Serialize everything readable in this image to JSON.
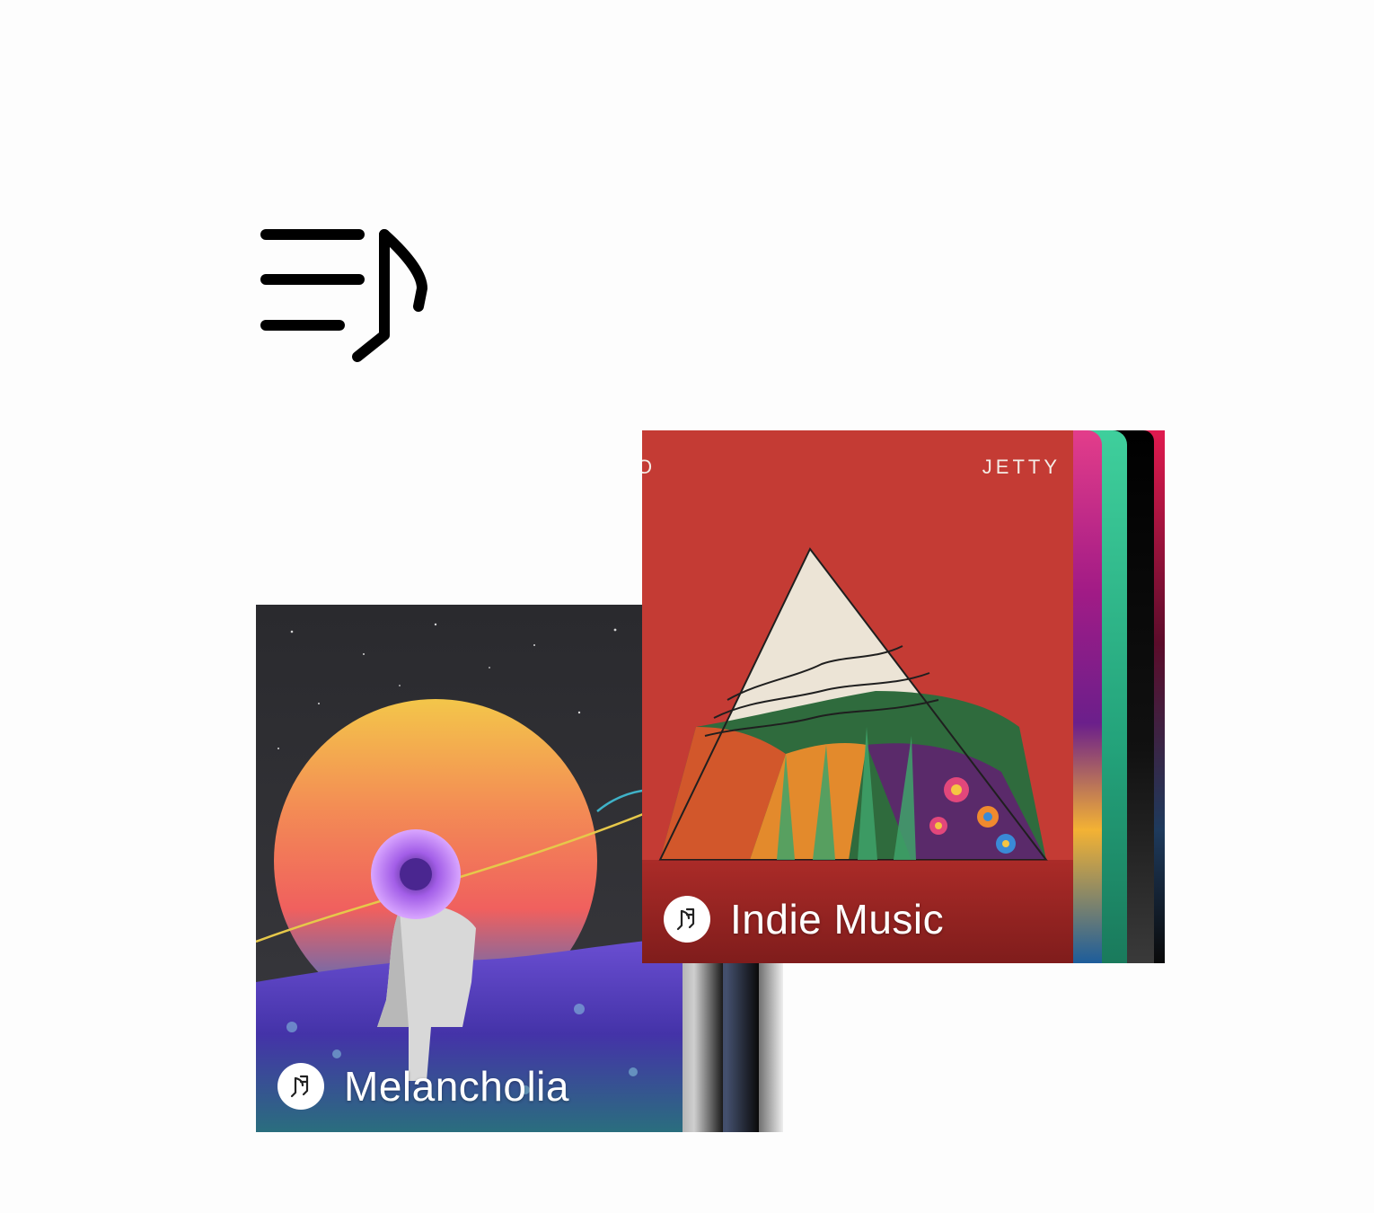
{
  "playlist_icon": "playlist-music-icon",
  "cards": {
    "melancholia": {
      "title": "Melancholia",
      "badge_icon": "music-note-icon"
    },
    "indie": {
      "title": "Indie Music",
      "badge_icon": "music-note-icon",
      "cover_text_right": "JETTY",
      "cover_text_left": "O"
    }
  },
  "colors": {
    "background": "#fdfdfd",
    "indie_cover": "#c43b34",
    "label_text": "#ffffff"
  }
}
